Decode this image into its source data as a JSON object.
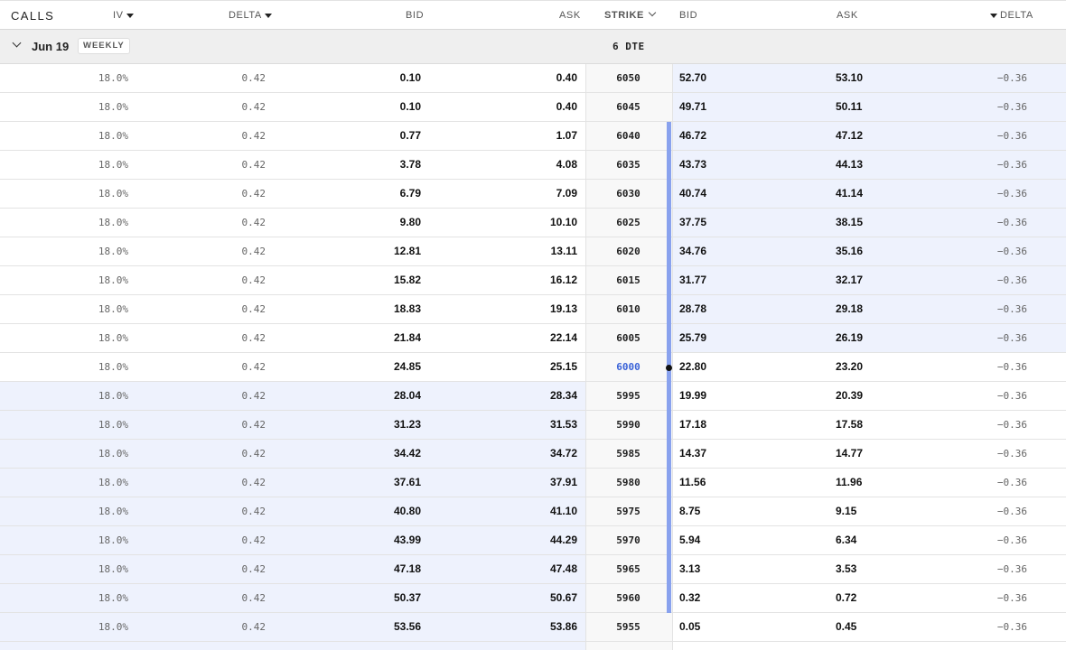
{
  "header": {
    "calls_label": "CALLS",
    "iv_label": "IV",
    "delta_label": "DELTA",
    "bid_label": "BID",
    "ask_label": "ASK",
    "strike_label": "STRIKE",
    "put_bid_label": "BID",
    "put_ask_label": "ASK",
    "put_delta_label": "DELTA"
  },
  "expiry_group": {
    "date": "Jun 19",
    "badge": "WEEKLY",
    "dte": "6 DTE"
  },
  "colors": {
    "itm_background": "#eef2fd",
    "atm_strike": "#3b63d8",
    "marker_bar": "#89a2ee"
  },
  "rows": [
    {
      "iv": "18.0%",
      "delta": "0.42",
      "bid": "0.10",
      "ask": "0.40",
      "strike": "6050",
      "put_bid": "52.70",
      "put_ask": "53.10",
      "put_delta": "−0.36",
      "call_itm": false,
      "put_itm": true,
      "marker": false,
      "atm": false
    },
    {
      "iv": "18.0%",
      "delta": "0.42",
      "bid": "0.10",
      "ask": "0.40",
      "strike": "6045",
      "put_bid": "49.71",
      "put_ask": "50.11",
      "put_delta": "−0.36",
      "call_itm": false,
      "put_itm": true,
      "marker": false,
      "atm": false
    },
    {
      "iv": "18.0%",
      "delta": "0.42",
      "bid": "0.77",
      "ask": "1.07",
      "strike": "6040",
      "put_bid": "46.72",
      "put_ask": "47.12",
      "put_delta": "−0.36",
      "call_itm": false,
      "put_itm": true,
      "marker": true,
      "atm": false
    },
    {
      "iv": "18.0%",
      "delta": "0.42",
      "bid": "3.78",
      "ask": "4.08",
      "strike": "6035",
      "put_bid": "43.73",
      "put_ask": "44.13",
      "put_delta": "−0.36",
      "call_itm": false,
      "put_itm": true,
      "marker": true,
      "atm": false
    },
    {
      "iv": "18.0%",
      "delta": "0.42",
      "bid": "6.79",
      "ask": "7.09",
      "strike": "6030",
      "put_bid": "40.74",
      "put_ask": "41.14",
      "put_delta": "−0.36",
      "call_itm": false,
      "put_itm": true,
      "marker": true,
      "atm": false
    },
    {
      "iv": "18.0%",
      "delta": "0.42",
      "bid": "9.80",
      "ask": "10.10",
      "strike": "6025",
      "put_bid": "37.75",
      "put_ask": "38.15",
      "put_delta": "−0.36",
      "call_itm": false,
      "put_itm": true,
      "marker": true,
      "atm": false
    },
    {
      "iv": "18.0%",
      "delta": "0.42",
      "bid": "12.81",
      "ask": "13.11",
      "strike": "6020",
      "put_bid": "34.76",
      "put_ask": "35.16",
      "put_delta": "−0.36",
      "call_itm": false,
      "put_itm": true,
      "marker": true,
      "atm": false
    },
    {
      "iv": "18.0%",
      "delta": "0.42",
      "bid": "15.82",
      "ask": "16.12",
      "strike": "6015",
      "put_bid": "31.77",
      "put_ask": "32.17",
      "put_delta": "−0.36",
      "call_itm": false,
      "put_itm": true,
      "marker": true,
      "atm": false
    },
    {
      "iv": "18.0%",
      "delta": "0.42",
      "bid": "18.83",
      "ask": "19.13",
      "strike": "6010",
      "put_bid": "28.78",
      "put_ask": "29.18",
      "put_delta": "−0.36",
      "call_itm": false,
      "put_itm": true,
      "marker": true,
      "atm": false
    },
    {
      "iv": "18.0%",
      "delta": "0.42",
      "bid": "21.84",
      "ask": "22.14",
      "strike": "6005",
      "put_bid": "25.79",
      "put_ask": "26.19",
      "put_delta": "−0.36",
      "call_itm": false,
      "put_itm": true,
      "marker": true,
      "atm": false
    },
    {
      "iv": "18.0%",
      "delta": "0.42",
      "bid": "24.85",
      "ask": "25.15",
      "strike": "6000",
      "put_bid": "22.80",
      "put_ask": "23.20",
      "put_delta": "−0.36",
      "call_itm": false,
      "put_itm": false,
      "marker": true,
      "atm": true
    },
    {
      "iv": "18.0%",
      "delta": "0.42",
      "bid": "28.04",
      "ask": "28.34",
      "strike": "5995",
      "put_bid": "19.99",
      "put_ask": "20.39",
      "put_delta": "−0.36",
      "call_itm": true,
      "put_itm": false,
      "marker": true,
      "atm": false
    },
    {
      "iv": "18.0%",
      "delta": "0.42",
      "bid": "31.23",
      "ask": "31.53",
      "strike": "5990",
      "put_bid": "17.18",
      "put_ask": "17.58",
      "put_delta": "−0.36",
      "call_itm": true,
      "put_itm": false,
      "marker": true,
      "atm": false
    },
    {
      "iv": "18.0%",
      "delta": "0.42",
      "bid": "34.42",
      "ask": "34.72",
      "strike": "5985",
      "put_bid": "14.37",
      "put_ask": "14.77",
      "put_delta": "−0.36",
      "call_itm": true,
      "put_itm": false,
      "marker": true,
      "atm": false
    },
    {
      "iv": "18.0%",
      "delta": "0.42",
      "bid": "37.61",
      "ask": "37.91",
      "strike": "5980",
      "put_bid": "11.56",
      "put_ask": "11.96",
      "put_delta": "−0.36",
      "call_itm": true,
      "put_itm": false,
      "marker": true,
      "atm": false
    },
    {
      "iv": "18.0%",
      "delta": "0.42",
      "bid": "40.80",
      "ask": "41.10",
      "strike": "5975",
      "put_bid": "8.75",
      "put_ask": "9.15",
      "put_delta": "−0.36",
      "call_itm": true,
      "put_itm": false,
      "marker": true,
      "atm": false
    },
    {
      "iv": "18.0%",
      "delta": "0.42",
      "bid": "43.99",
      "ask": "44.29",
      "strike": "5970",
      "put_bid": "5.94",
      "put_ask": "6.34",
      "put_delta": "−0.36",
      "call_itm": true,
      "put_itm": false,
      "marker": true,
      "atm": false
    },
    {
      "iv": "18.0%",
      "delta": "0.42",
      "bid": "47.18",
      "ask": "47.48",
      "strike": "5965",
      "put_bid": "3.13",
      "put_ask": "3.53",
      "put_delta": "−0.36",
      "call_itm": true,
      "put_itm": false,
      "marker": true,
      "atm": false
    },
    {
      "iv": "18.0%",
      "delta": "0.42",
      "bid": "50.37",
      "ask": "50.67",
      "strike": "5960",
      "put_bid": "0.32",
      "put_ask": "0.72",
      "put_delta": "−0.36",
      "call_itm": true,
      "put_itm": false,
      "marker": true,
      "atm": false
    },
    {
      "iv": "18.0%",
      "delta": "0.42",
      "bid": "53.56",
      "ask": "53.86",
      "strike": "5955",
      "put_bid": "0.05",
      "put_ask": "0.45",
      "put_delta": "−0.36",
      "call_itm": true,
      "put_itm": false,
      "marker": false,
      "atm": false
    }
  ]
}
